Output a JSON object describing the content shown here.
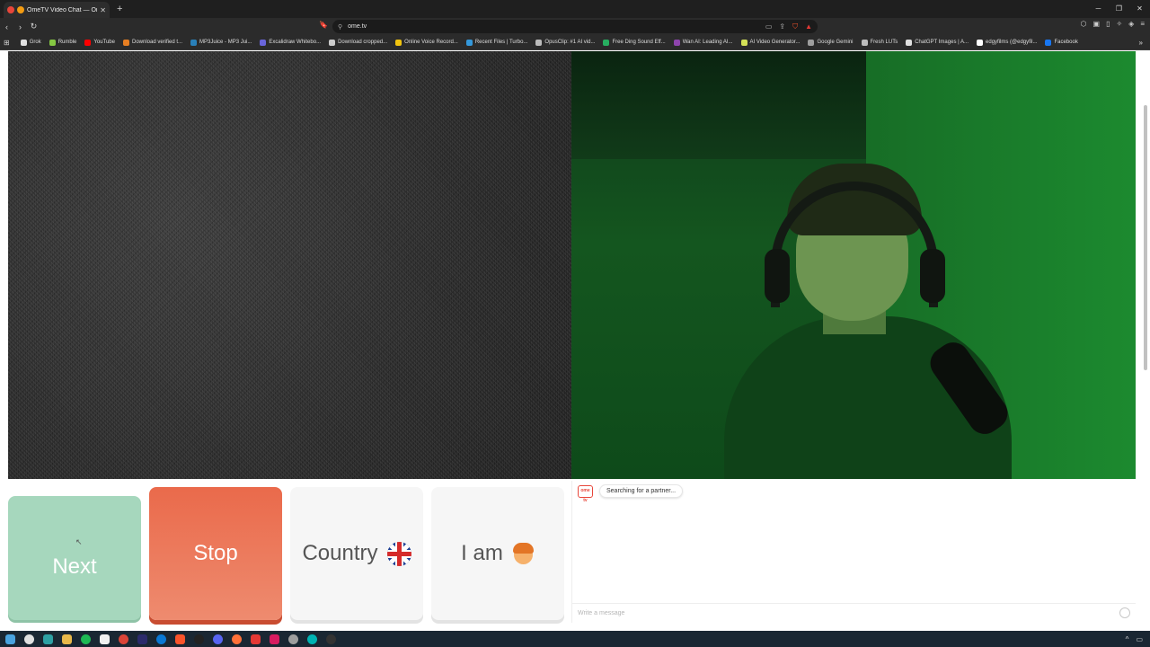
{
  "browser": {
    "tab_title": "OmeTV Video Chat — Omegle",
    "new_tab_symbol": "+",
    "url": "ome.tv",
    "bookmarks": [
      {
        "label": "Grok",
        "color": "#e0e0e0"
      },
      {
        "label": "Rumble",
        "color": "#85c742"
      },
      {
        "label": "YouTube",
        "color": "#ff0000"
      },
      {
        "label": "Download verified t...",
        "color": "#e67e22"
      },
      {
        "label": "MP3Juice - MP3 Jui...",
        "color": "#2980b9"
      },
      {
        "label": "Excalidraw Whitebo...",
        "color": "#6965db"
      },
      {
        "label": "Download cropped...",
        "color": "#cccccc"
      },
      {
        "label": "Online Voice Record...",
        "color": "#f1c40f"
      },
      {
        "label": "Recent Files | Turbo...",
        "color": "#3498db"
      },
      {
        "label": "OpusClip: #1 AI vid...",
        "color": "#bbbbbb"
      },
      {
        "label": "Free Ding Sound Eff...",
        "color": "#27ae60"
      },
      {
        "label": "Wan AI: Leading AI...",
        "color": "#8e44ad"
      },
      {
        "label": "AI Video Generator...",
        "color": "#d4e157"
      },
      {
        "label": "Google Gemini",
        "color": "#9e9e9e"
      },
      {
        "label": "Fresh LUTs",
        "color": "#bdbdbd"
      },
      {
        "label": "ChatGPT Images | A...",
        "color": "#e0e0e0"
      },
      {
        "label": "edgyfilms (@edgyfil...",
        "color": "#ffffff"
      },
      {
        "label": "Facebook",
        "color": "#1877f2"
      }
    ]
  },
  "controls": {
    "next_label": "Next",
    "stop_label": "Stop",
    "country_label": "Country",
    "iam_label": "I am"
  },
  "chat": {
    "status_message": "Searching for a partner...",
    "logo_text": "ome tv",
    "input_placeholder": "Write a message"
  },
  "colors": {
    "next": "#a6d7bd",
    "stop": "#ea6a4b",
    "neutral_button": "#f6f6f6",
    "brand": "#e8463a"
  }
}
